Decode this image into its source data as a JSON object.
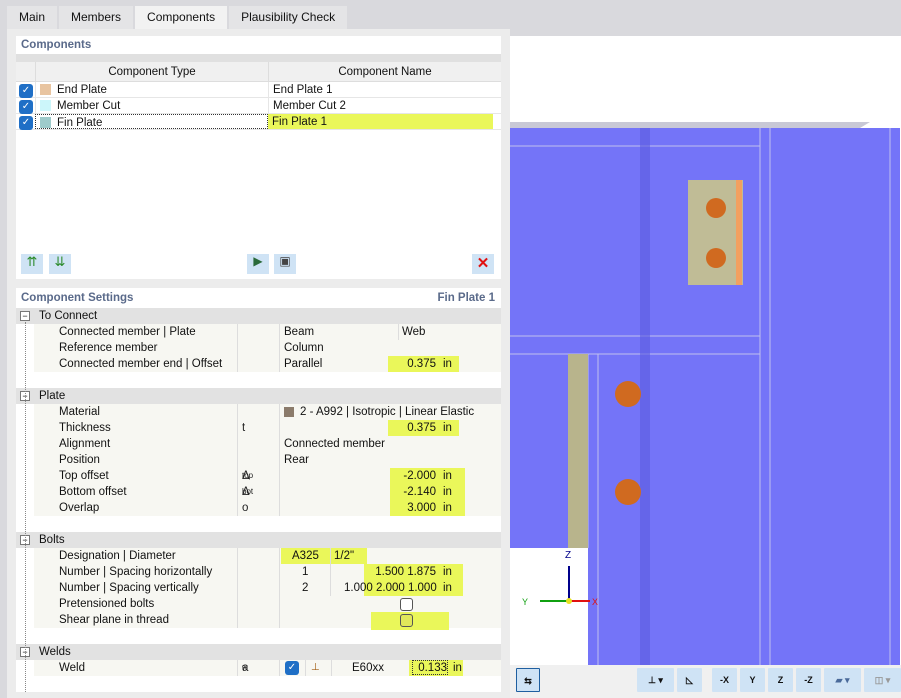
{
  "tabs": [
    "Main",
    "Members",
    "Components",
    "Plausibility Check"
  ],
  "active_tab": "Components",
  "components": {
    "title": "Components",
    "headers": [
      "Component Type",
      "Component Name"
    ],
    "rows": [
      {
        "checked": true,
        "type": "End Plate",
        "name": "End Plate 1",
        "color": "#e8c4a0"
      },
      {
        "checked": true,
        "type": "Member Cut",
        "name": "Member Cut 2",
        "color": "#ccf6fa"
      },
      {
        "checked": true,
        "type": "Fin Plate",
        "name": "Fin Plate 1",
        "color": "#9ecbcb"
      }
    ]
  },
  "settings": {
    "title": "Component Settings",
    "current": "Fin Plate 1",
    "groups": {
      "to_connect": {
        "label": "To Connect",
        "rows": [
          {
            "label": "Connected member | Plate",
            "v1": "Beam",
            "v2": "Web"
          },
          {
            "label": "Reference member",
            "v1": "Column"
          },
          {
            "label": "Connected member end | Offset",
            "v1": "Parallel",
            "value": "0.375",
            "unit": "in"
          }
        ]
      },
      "plate": {
        "label": "Plate",
        "rows": [
          {
            "label": "Material",
            "v1": "2 - A992 | Isotropic | Linear Elastic",
            "color": "#8b7b6b"
          },
          {
            "label": "Thickness",
            "sym": "t",
            "value": "0.375",
            "unit": "in"
          },
          {
            "label": "Alignment",
            "v1": "Connected member"
          },
          {
            "label": "Position",
            "v1": "Rear"
          },
          {
            "label": "Top offset",
            "sym": "Δ",
            "sub": "top",
            "value": "-2.000",
            "unit": "in"
          },
          {
            "label": "Bottom offset",
            "sym": "Δ",
            "sub": "bot",
            "value": "-2.140",
            "unit": "in"
          },
          {
            "label": "Overlap",
            "sym": "o",
            "value": "3.000",
            "unit": "in"
          }
        ]
      },
      "bolts": {
        "label": "Bolts",
        "rows": [
          {
            "label": "Designation | Diameter",
            "v1": "A325",
            "v2": "1/2\""
          },
          {
            "label": "Number | Spacing horizontally",
            "n": "1",
            "value": "1.500 1.875",
            "unit": "in"
          },
          {
            "label": "Number | Spacing vertically",
            "n": "2",
            "value": "1.000 2.000 1.000",
            "unit": "in"
          },
          {
            "label": "Pretensioned bolts",
            "checked": false
          },
          {
            "label": "Shear plane in thread",
            "checked": false
          }
        ]
      },
      "welds": {
        "label": "Welds",
        "rows": [
          {
            "label": "Weld",
            "sym": "a",
            "sub": "w",
            "checked": true,
            "v1": "E60xx",
            "value": "0.133",
            "unit": "in"
          }
        ]
      }
    }
  },
  "view": {
    "axes": {
      "x": "X",
      "y": "Y",
      "z": "Z"
    },
    "toolbar": [
      "-X",
      "Y",
      "Z",
      "-Z"
    ]
  }
}
